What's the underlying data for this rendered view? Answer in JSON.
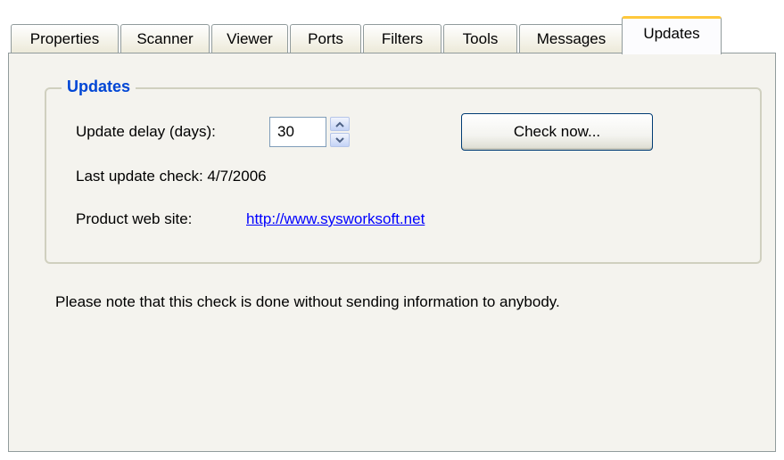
{
  "tabs": [
    {
      "label": "Properties",
      "active": false
    },
    {
      "label": "Scanner",
      "active": false
    },
    {
      "label": "Viewer",
      "active": false
    },
    {
      "label": "Ports",
      "active": false
    },
    {
      "label": "Filters",
      "active": false
    },
    {
      "label": "Tools",
      "active": false
    },
    {
      "label": "Messages",
      "active": false
    },
    {
      "label": "Updates",
      "active": true
    }
  ],
  "updates_group": {
    "title": "Updates",
    "delay_label": "Update delay (days):",
    "delay_value": "30",
    "check_button": "Check now...",
    "last_check_label": "Last update check: 4/7/2006",
    "website_label": "Product web site:",
    "website_link": "http://www.sysworksoft.net"
  },
  "note": "Please note that this check is done without sending information to anybody.",
  "colors": {
    "group_title": "#0046d5",
    "link": "#0000ff",
    "active_tab_accent": "#ffc83c",
    "panel_bg": "#f4f3ee"
  }
}
